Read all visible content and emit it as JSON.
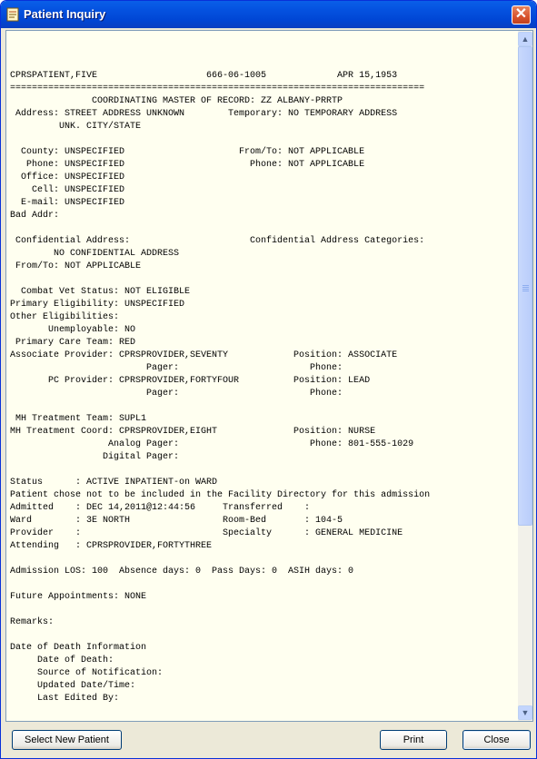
{
  "window": {
    "title": "Patient Inquiry",
    "close_glyph": "✕",
    "icon": "patient-document-icon"
  },
  "report_lines": [
    "CPRSPATIENT,FIVE                    666-06-1005             APR 15,1953",
    "============================================================================",
    "               COORDINATING MASTER OF RECORD: ZZ ALBANY-PRRTP",
    " Address: STREET ADDRESS UNKNOWN        Temporary: NO TEMPORARY ADDRESS",
    "         UNK. CITY/STATE",
    "",
    "  County: UNSPECIFIED                     From/To: NOT APPLICABLE",
    "   Phone: UNSPECIFIED                       Phone: NOT APPLICABLE",
    "  Office: UNSPECIFIED",
    "    Cell: UNSPECIFIED",
    "  E-mail: UNSPECIFIED",
    "Bad Addr:",
    "",
    " Confidential Address:                      Confidential Address Categories:",
    "        NO CONFIDENTIAL ADDRESS",
    " From/To: NOT APPLICABLE",
    "",
    "  Combat Vet Status: NOT ELIGIBLE",
    "Primary Eligibility: UNSPECIFIED",
    "Other Eligibilities:",
    "       Unemployable: NO",
    " Primary Care Team: RED",
    "Associate Provider: CPRSPROVIDER,SEVENTY            Position: ASSOCIATE",
    "                         Pager:                        Phone:",
    "       PC Provider: CPRSPROVIDER,FORTYFOUR          Position: LEAD",
    "                         Pager:                        Phone:",
    "",
    " MH Treatment Team: SUPL1",
    "MH Treatment Coord: CPRSPROVIDER,EIGHT              Position: NURSE",
    "                  Analog Pager:                        Phone: 801-555-1029",
    "                 Digital Pager:",
    "",
    "Status      : ACTIVE INPATIENT-on WARD",
    "Patient chose not to be included in the Facility Directory for this admission",
    "Admitted    : DEC 14,2011@12:44:56     Transferred    :",
    "Ward        : 3E NORTH                 Room-Bed       : 104-5",
    "Provider    :                          Specialty      : GENERAL MEDICINE",
    "Attending   : CPRSPROVIDER,FORTYTHREE",
    "",
    "Admission LOS: 100  Absence days: 0  Pass Days: 0  ASIH days: 0",
    "",
    "Future Appointments: NONE",
    "",
    "Remarks:",
    "",
    "Date of Death Information",
    "     Date of Death:",
    "     Source of Notification:",
    "     Updated Date/Time:",
    "     Last Edited By:"
  ],
  "scrollbar": {
    "up_glyph": "▲",
    "down_glyph": "▼"
  },
  "buttons": {
    "select_new_patient": "Select New Patient",
    "print": "Print",
    "close": "Close"
  },
  "colors": {
    "titlebar": "#0553e1",
    "report_background": "#fffff0",
    "window_face": "#ece9d8"
  }
}
